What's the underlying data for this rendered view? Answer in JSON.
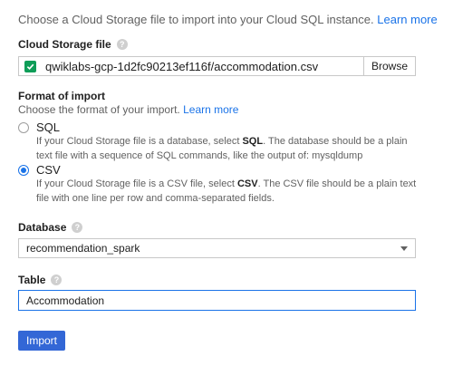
{
  "intro": {
    "text": "Choose a Cloud Storage file to import into your Cloud SQL instance.",
    "learn_more": "Learn more"
  },
  "file": {
    "label": "Cloud Storage file",
    "value": "qwiklabs-gcp-1d2fc90213ef116f/accommodation.csv",
    "browse": "Browse"
  },
  "format": {
    "label": "Format of import",
    "description": "Choose the format of your import.",
    "learn_more": "Learn more",
    "options": [
      {
        "label": "SQL",
        "help_pre": "If your Cloud Storage file is a database, select ",
        "help_bold": "SQL",
        "help_post": ". The database should be a plain text file with a sequence of SQL commands, like the output of: mysqldump",
        "selected": false
      },
      {
        "label": "CSV",
        "help_pre": "If your Cloud Storage file is a CSV file, select ",
        "help_bold": "CSV",
        "help_post": ". The CSV file should be a plain text file with one line per row and comma-separated fields.",
        "selected": true
      }
    ]
  },
  "database": {
    "label": "Database",
    "selected": "recommendation_spark"
  },
  "table": {
    "label": "Table",
    "value": "Accommodation"
  },
  "actions": {
    "import": "Import"
  },
  "colors": {
    "accent": "#1a73e8",
    "button": "#3367d6",
    "success": "#0f9d58"
  }
}
